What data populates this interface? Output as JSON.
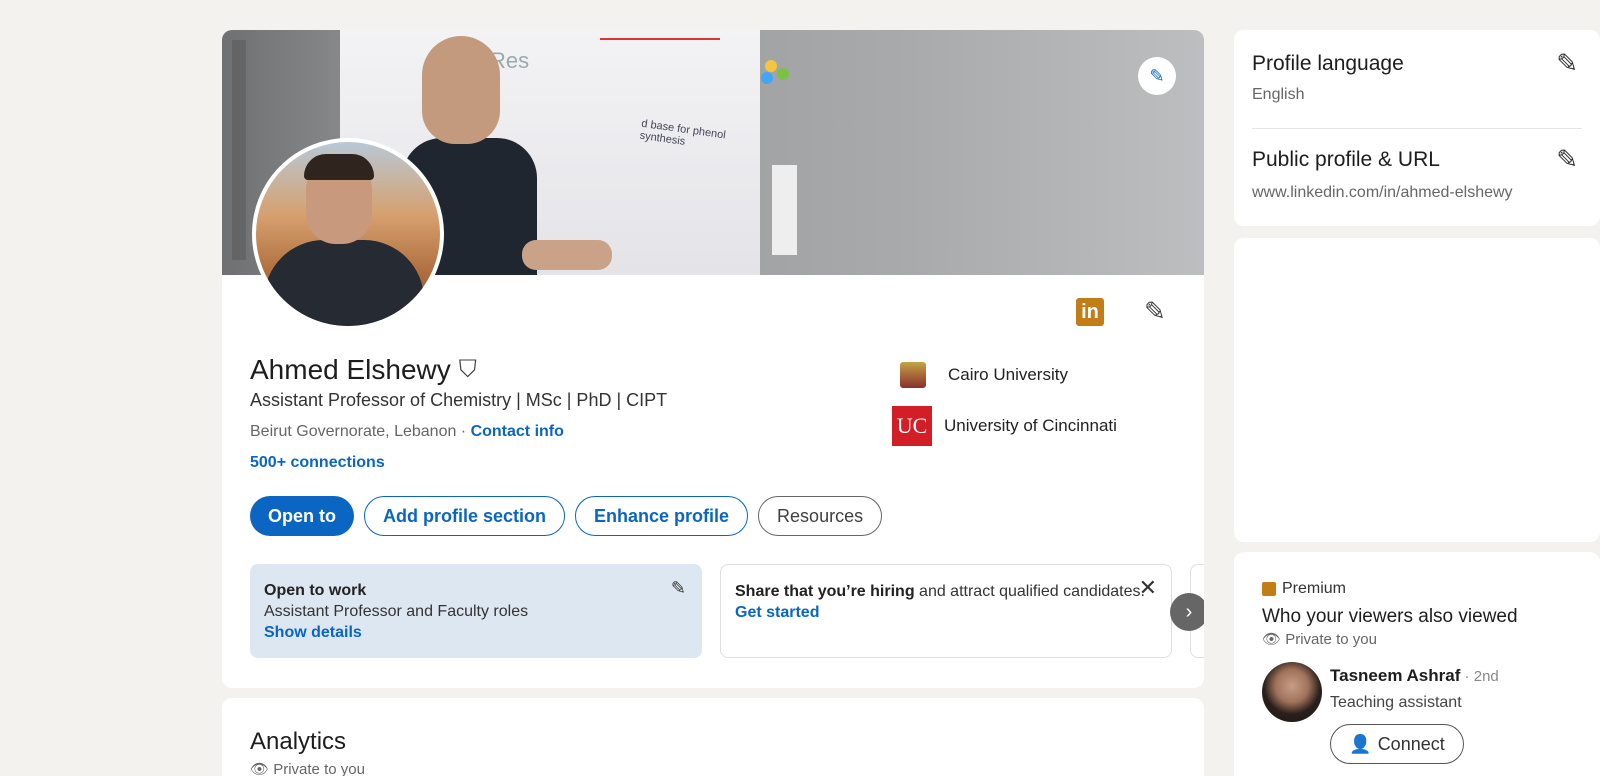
{
  "profile": {
    "name": "Ahmed Elshewy",
    "headline": "Assistant Professor of Chemistry | MSc | PhD | CIPT",
    "location": "Beirut Governorate, Lebanon",
    "location_sep": " · ",
    "contact_label": "Contact info",
    "connections": "500+ connections",
    "education": [
      {
        "name": "Cairo University",
        "icon": "university-crest-icon"
      },
      {
        "name": "University of Cincinnati",
        "icon": "uc-logo-icon",
        "logo_text": "UC"
      }
    ],
    "badge_text": "in"
  },
  "actions": {
    "open_to": "Open to",
    "add_section": "Add profile section",
    "enhance": "Enhance profile",
    "resources": "Resources"
  },
  "open_to_work": {
    "title": "Open to work",
    "roles": "Assistant Professor and Faculty roles",
    "link": "Show details"
  },
  "hiring": {
    "strong": "Share that you’re hiring",
    "rest": " and attract qualified candidates.",
    "link": "Get started"
  },
  "analytics": {
    "title": "Analytics",
    "private": "Private to you"
  },
  "settings": {
    "language_title": "Profile language",
    "language_value": "English",
    "url_title": "Public profile & URL",
    "url_value": "www.linkedin.com/in/ahmed-elshewy"
  },
  "premium": {
    "label": "Premium",
    "title": "Who your viewers also viewed",
    "private": "Private to you",
    "viewer": {
      "name": "Tasneem Ashraf",
      "degree": " · 2nd",
      "role": "Teaching assistant",
      "connect": "Connect"
    }
  },
  "colors": {
    "accent": "#0a66c2",
    "premium": "#c37d16",
    "background": "#f3f2ef"
  }
}
